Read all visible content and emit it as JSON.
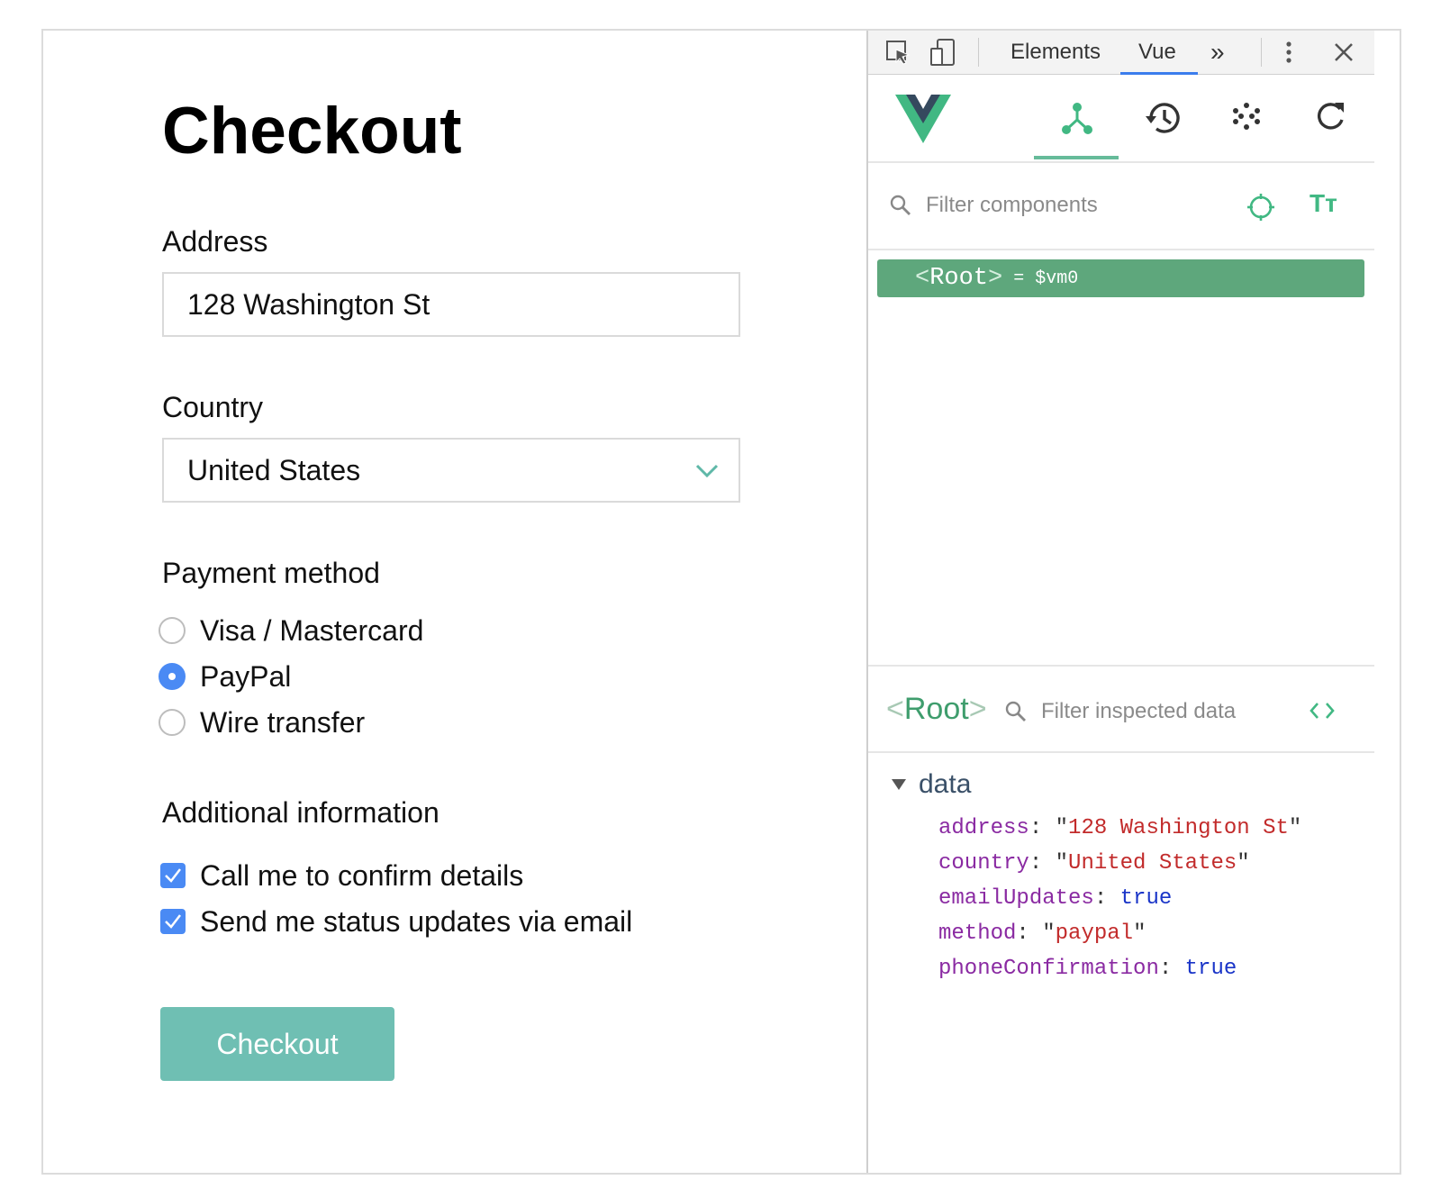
{
  "app": {
    "title": "Checkout",
    "address": {
      "label": "Address",
      "value": "128 Washington St"
    },
    "country": {
      "label": "Country",
      "value": "United States"
    },
    "payment": {
      "label": "Payment method",
      "options": [
        {
          "label": "Visa / Mastercard",
          "checked": false
        },
        {
          "label": "PayPal",
          "checked": true
        },
        {
          "label": "Wire transfer",
          "checked": false
        }
      ]
    },
    "additional": {
      "label": "Additional information",
      "options": [
        {
          "label": "Call me to confirm details",
          "checked": true
        },
        {
          "label": "Send me status updates via email",
          "checked": true
        }
      ]
    },
    "submit_label": "Checkout",
    "colors": {
      "accent": "#6fbfb3",
      "control": "#4a8af4"
    }
  },
  "devtools": {
    "tabs": {
      "elements": "Elements",
      "vue": "Vue",
      "more": "»"
    },
    "icons": [
      "inspect-element-icon",
      "device-toolbar-icon",
      "more-options-icon",
      "close-icon"
    ],
    "vue_toolbar": [
      "components-tree-icon",
      "history-icon",
      "vuex-icon",
      "refresh-icon"
    ],
    "filter_placeholder": "Filter components",
    "root_row": {
      "tag": "Root",
      "assignment": "= $vm0"
    },
    "inspector": {
      "component": "Root",
      "filter_placeholder": "Filter inspected data",
      "section": "data",
      "props": [
        {
          "key": "address",
          "value": "128 Washington St",
          "type": "string"
        },
        {
          "key": "country",
          "value": "United States",
          "type": "string"
        },
        {
          "key": "emailUpdates",
          "value": "true",
          "type": "boolean"
        },
        {
          "key": "method",
          "value": "paypal",
          "type": "string"
        },
        {
          "key": "phoneConfirmation",
          "value": "true",
          "type": "boolean"
        }
      ]
    },
    "colors": {
      "vue_green": "#5ea77c",
      "tab_underline": "#3b7ded"
    }
  }
}
